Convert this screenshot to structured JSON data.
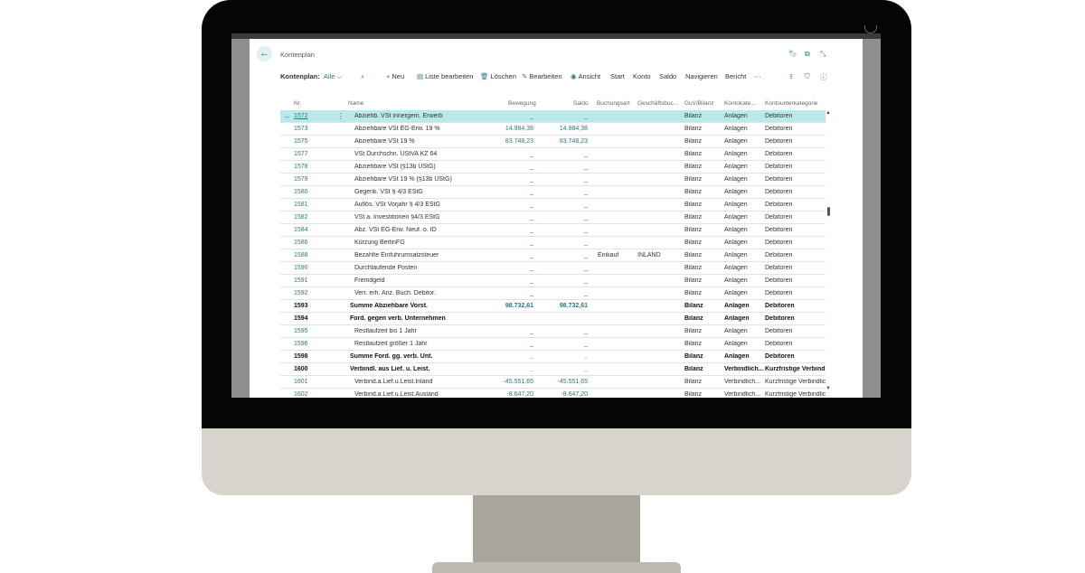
{
  "page": {
    "title": "Kontenplan",
    "filter_label": "Kontenplan:",
    "filter_value": "Alle"
  },
  "actions": {
    "new": "Neu",
    "edit_list": "Liste bearbeiten",
    "delete": "Löschen",
    "edit": "Bearbeiten",
    "view": "Ansicht",
    "start": "Start",
    "account": "Konto",
    "balance": "Saldo",
    "navigate": "Navigieren",
    "report": "Bericht",
    "more": "···"
  },
  "columns": {
    "nr": "Nr.",
    "name": "Name",
    "bewegung": "Bewegung",
    "saldo": "Saldo",
    "buchungsart": "Buchungsart",
    "geschaeftsbuch": "Geschäftsbuc...",
    "guv": "GuV/Bilanz",
    "kontokat": "Kontokate...",
    "kontounterkat": "Kontounterkategorie"
  },
  "rows": [
    {
      "nr": "1572",
      "name": "Abziehb. VSt innergem. Erwerb",
      "bew": "_",
      "sal": "_",
      "ba": "",
      "gb": "",
      "guv": "Bilanz",
      "kk": "Anlagen",
      "ku": "Debitoren",
      "bold": false,
      "selected": true
    },
    {
      "nr": "1573",
      "name": "Abziehbare VSt EG-Erw. 19 %",
      "bew": "14.984,38",
      "sal": "14.984,38",
      "ba": "",
      "gb": "",
      "guv": "Bilanz",
      "kk": "Anlagen",
      "ku": "Debitoren",
      "bold": false
    },
    {
      "nr": "1575",
      "name": "Abziehbare VSt 19 %",
      "bew": "83.748,23",
      "sal": "83.748,23",
      "ba": "",
      "gb": "",
      "guv": "Bilanz",
      "kk": "Anlagen",
      "ku": "Debitoren",
      "bold": false
    },
    {
      "nr": "1577",
      "name": "VSt Durchschn. UStVA KZ 64",
      "bew": "_",
      "sal": "_",
      "ba": "",
      "gb": "",
      "guv": "Bilanz",
      "kk": "Anlagen",
      "ku": "Debitoren",
      "bold": false
    },
    {
      "nr": "1578",
      "name": "Abziehbare VSt (§13b UStG)",
      "bew": "_",
      "sal": "_",
      "ba": "",
      "gb": "",
      "guv": "Bilanz",
      "kk": "Anlagen",
      "ku": "Debitoren",
      "bold": false
    },
    {
      "nr": "1579",
      "name": "Abziehbare VSt 19 % (§13b UStG)",
      "bew": "_",
      "sal": "_",
      "ba": "",
      "gb": "",
      "guv": "Bilanz",
      "kk": "Anlagen",
      "ku": "Debitoren",
      "bold": false
    },
    {
      "nr": "1580",
      "name": "Gegenk. VSt § 4/3 EStG",
      "bew": "_",
      "sal": "_",
      "ba": "",
      "gb": "",
      "guv": "Bilanz",
      "kk": "Anlagen",
      "ku": "Debitoren",
      "bold": false
    },
    {
      "nr": "1581",
      "name": "Auflös. VSt Vorjahr § 4/3 EStG",
      "bew": "_",
      "sal": "_",
      "ba": "",
      "gb": "",
      "guv": "Bilanz",
      "kk": "Anlagen",
      "ku": "Debitoren",
      "bold": false
    },
    {
      "nr": "1582",
      "name": "VSt a. Investitionen §4/3 EStG",
      "bew": "_",
      "sal": "_",
      "ba": "",
      "gb": "",
      "guv": "Bilanz",
      "kk": "Anlagen",
      "ku": "Debitoren",
      "bold": false
    },
    {
      "nr": "1584",
      "name": "Abz. VSt EG-Erw. Neuf. o. ID",
      "bew": "_",
      "sal": "_",
      "ba": "",
      "gb": "",
      "guv": "Bilanz",
      "kk": "Anlagen",
      "ku": "Debitoren",
      "bold": false
    },
    {
      "nr": "1586",
      "name": "Kürzung BerlinFG",
      "bew": "_",
      "sal": "_",
      "ba": "",
      "gb": "",
      "guv": "Bilanz",
      "kk": "Anlagen",
      "ku": "Debitoren",
      "bold": false
    },
    {
      "nr": "1588",
      "name": "Bezahlte Einfuhrumsatzsteuer",
      "bew": "_",
      "sal": "_",
      "ba": "Einkauf",
      "gb": "INLAND",
      "guv": "Bilanz",
      "kk": "Anlagen",
      "ku": "Debitoren",
      "bold": false
    },
    {
      "nr": "1590",
      "name": "Durchlaufende Posten",
      "bew": "_",
      "sal": "_",
      "ba": "",
      "gb": "",
      "guv": "Bilanz",
      "kk": "Anlagen",
      "ku": "Debitoren",
      "bold": false
    },
    {
      "nr": "1591",
      "name": "Fremdgeld",
      "bew": "_",
      "sal": "_",
      "ba": "",
      "gb": "",
      "guv": "Bilanz",
      "kk": "Anlagen",
      "ku": "Debitoren",
      "bold": false
    },
    {
      "nr": "1592",
      "name": "Verr. erh. Anz. Buch. Debitor.",
      "bew": "_",
      "sal": "_",
      "ba": "",
      "gb": "",
      "guv": "Bilanz",
      "kk": "Anlagen",
      "ku": "Debitoren",
      "bold": false
    },
    {
      "nr": "1593",
      "name": "Summe Abziehbare Vorst.",
      "bew": "98.732,61",
      "sal": "98.732,61",
      "ba": "",
      "gb": "",
      "guv": "Bilanz",
      "kk": "Anlagen",
      "ku": "Debitoren",
      "bold": true
    },
    {
      "nr": "1594",
      "name": "Ford. gegen verb. Unternehmen",
      "bew": "",
      "sal": "",
      "ba": "",
      "gb": "",
      "guv": "Bilanz",
      "kk": "Anlagen",
      "ku": "Debitoren",
      "bold": true
    },
    {
      "nr": "1595",
      "name": "Restlaufzeit bis 1 Jahr",
      "bew": "_",
      "sal": "_",
      "ba": "",
      "gb": "",
      "guv": "Bilanz",
      "kk": "Anlagen",
      "ku": "Debitoren",
      "bold": false
    },
    {
      "nr": "1596",
      "name": "Restlaufzeit größer 1 Jahr",
      "bew": "_",
      "sal": "_",
      "ba": "",
      "gb": "",
      "guv": "Bilanz",
      "kk": "Anlagen",
      "ku": "Debitoren",
      "bold": false
    },
    {
      "nr": "1598",
      "name": "Summe Ford. gg. verb. Unt.",
      "bew": "_",
      "sal": "_",
      "ba": "",
      "gb": "",
      "guv": "Bilanz",
      "kk": "Anlagen",
      "ku": "Debitoren",
      "bold": true
    },
    {
      "nr": "1600",
      "name": "Verbindl. aus Lief. u. Leist.",
      "bew": "_",
      "sal": "_",
      "ba": "",
      "gb": "",
      "guv": "Bilanz",
      "kk": "Verbindlich...",
      "ku": "Kurzfristige Verbindlic",
      "bold": true
    },
    {
      "nr": "1601",
      "name": "Verbind.a.Lief.u.Leist.Inland",
      "bew": "-45.551,65",
      "sal": "-45.551,65",
      "ba": "",
      "gb": "",
      "guv": "Bilanz",
      "kk": "Verbindlich...",
      "ku": "Kurzfristige Verbindlic",
      "bold": false
    },
    {
      "nr": "1602",
      "name": "Verbind.a.Lief.u.Leist.Ausland",
      "bew": "-8.647,20",
      "sal": "-8.647,20",
      "ba": "",
      "gb": "",
      "guv": "Bilanz",
      "kk": "Verbindlich...",
      "ku": "Kurzfristige Verbindlic",
      "bold": false
    }
  ]
}
